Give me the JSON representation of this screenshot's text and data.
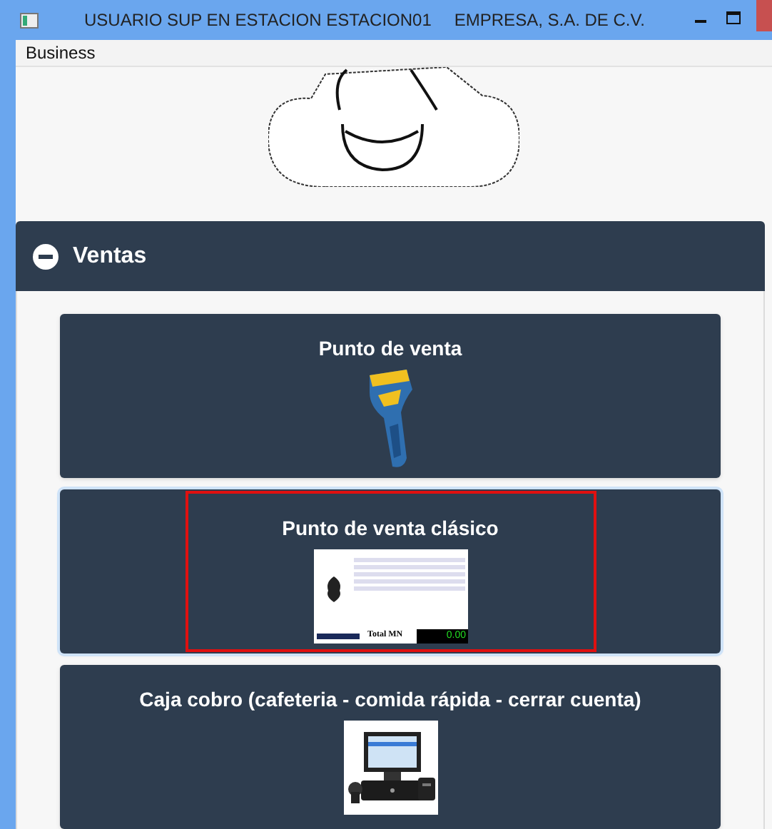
{
  "window": {
    "title": "USUARIO SUP EN ESTACION ESTACION01",
    "company": "EMPRESA, S.A. DE C.V."
  },
  "menu": [
    "Business"
  ],
  "section": {
    "title": "Ventas",
    "expanded": true,
    "items": [
      {
        "label": "Punto de venta",
        "kind": "scanner",
        "selected": false
      },
      {
        "label": "Punto de venta clásico",
        "kind": "screenshot",
        "selected": true,
        "preview": {
          "total_label": "Total MN",
          "total": "0.00"
        }
      },
      {
        "label": "Caja cobro (cafeteria - comida rápida - cerrar cuenta)",
        "kind": "terminal",
        "selected": false
      }
    ]
  }
}
